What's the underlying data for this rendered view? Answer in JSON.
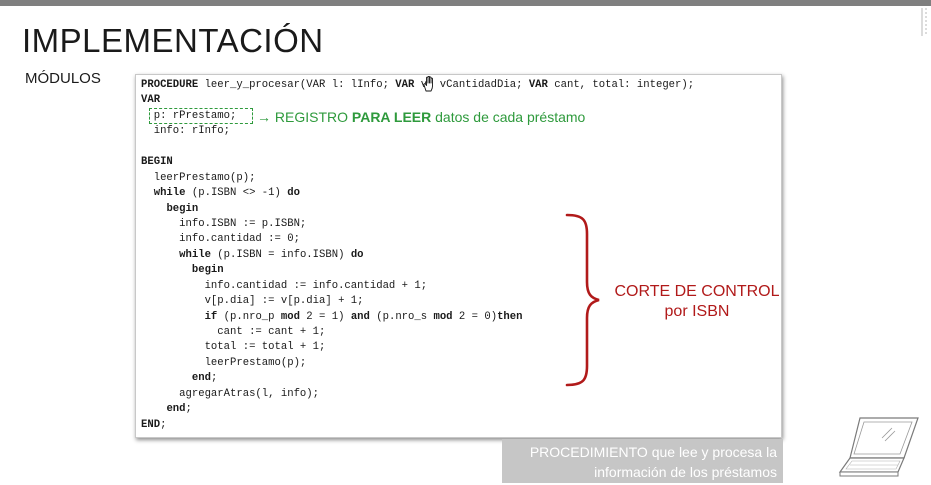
{
  "slide": {
    "title": "IMPLEMENTACIÓN",
    "subtitle": "MÓDULOS"
  },
  "code": {
    "lines": [
      [
        {
          "t": "PROCEDURE",
          "c": "kw"
        },
        {
          "t": " leer_y_procesar(VAR l: lInfo; "
        },
        {
          "t": "VAR",
          "c": "kw"
        },
        {
          "t": " v: vCantidadDia; "
        },
        {
          "t": "VAR",
          "c": "kw"
        },
        {
          "t": " cant, total: integer);"
        }
      ],
      [
        {
          "t": "VAR",
          "c": "kw"
        }
      ],
      [
        {
          "t": "  p: rPrestamo;"
        }
      ],
      [
        {
          "t": "  info: rInfo;"
        }
      ],
      [
        {
          "t": ""
        }
      ],
      [
        {
          "t": "BEGIN",
          "c": "kw"
        }
      ],
      [
        {
          "t": "  leerPrestamo(p);"
        }
      ],
      [
        {
          "t": "  "
        },
        {
          "t": "while",
          "c": "kw"
        },
        {
          "t": " (p.ISBN <> -1) "
        },
        {
          "t": "do",
          "c": "kw"
        }
      ],
      [
        {
          "t": "    "
        },
        {
          "t": "begin",
          "c": "kw"
        }
      ],
      [
        {
          "t": "      info.ISBN := p.ISBN;"
        }
      ],
      [
        {
          "t": "      info.cantidad := 0;"
        }
      ],
      [
        {
          "t": "      "
        },
        {
          "t": "while",
          "c": "kw"
        },
        {
          "t": " (p.ISBN = info.ISBN) "
        },
        {
          "t": "do",
          "c": "kw"
        }
      ],
      [
        {
          "t": "        "
        },
        {
          "t": "begin",
          "c": "kw"
        }
      ],
      [
        {
          "t": "          info.cantidad := info.cantidad + 1;"
        }
      ],
      [
        {
          "t": "          v[p.dia] := v[p.dia] + 1;"
        }
      ],
      [
        {
          "t": "          "
        },
        {
          "t": "if",
          "c": "kw"
        },
        {
          "t": " (p.nro_p "
        },
        {
          "t": "mod",
          "c": "kw"
        },
        {
          "t": " 2 = 1) "
        },
        {
          "t": "and",
          "c": "kw"
        },
        {
          "t": " (p.nro_s "
        },
        {
          "t": "mod",
          "c": "kw"
        },
        {
          "t": " 2 = 0)"
        },
        {
          "t": "then",
          "c": "kw"
        }
      ],
      [
        {
          "t": "            cant := cant + 1;"
        }
      ],
      [
        {
          "t": "          total := total + 1;"
        }
      ],
      [
        {
          "t": "          leerPrestamo(p);"
        }
      ],
      [
        {
          "t": "        "
        },
        {
          "t": "end",
          "c": "kw"
        },
        {
          "t": ";"
        }
      ],
      [
        {
          "t": "      agregarAtras(l, info);"
        }
      ],
      [
        {
          "t": "    "
        },
        {
          "t": "end",
          "c": "kw"
        },
        {
          "t": ";"
        }
      ],
      [
        {
          "t": "END",
          "c": "kw"
        },
        {
          "t": ";"
        }
      ]
    ]
  },
  "annotations": {
    "registro_arrow": "→",
    "registro_part1": "REGISTRO ",
    "registro_bold": "PARA LEER",
    "registro_part2": " datos de cada préstamo",
    "corte_line1": "CORTE DE CONTROL",
    "corte_line2": "por ISBN",
    "registro_color": "#2e9a3c",
    "corte_color": "#b11a1a"
  },
  "caption": {
    "line1": "PROCEDIMIENTO que lee y procesa la",
    "line2": "información de los préstamos"
  },
  "icons": {
    "cursor": "hand-cursor-icon",
    "device": "laptop-icon"
  }
}
